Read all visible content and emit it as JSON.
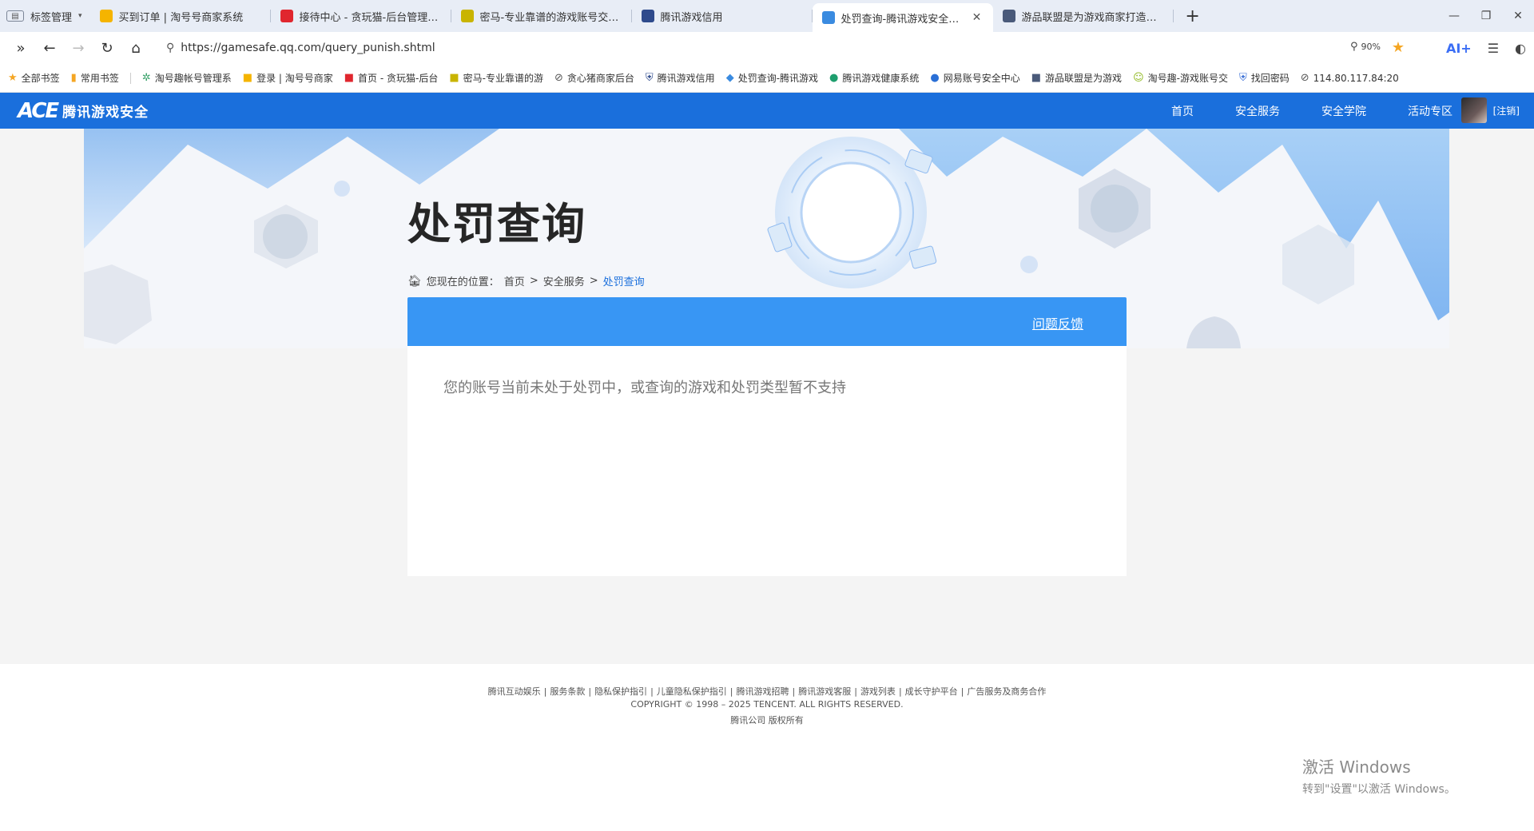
{
  "browser": {
    "tab_manager_label": "标签管理",
    "tabs": [
      {
        "title": "买到订单 | 淘号号商家系统",
        "favicon_color": "#f5b400"
      },
      {
        "title": "接待中心 - 贪玩猫-后台管理系统",
        "favicon_color": "#e0262e"
      },
      {
        "title": "密马-专业靠谱的游戏账号交易平",
        "favicon_color": "#c9b400"
      },
      {
        "title": "腾讯游戏信用",
        "favicon_color": "#2e4a8c"
      },
      {
        "title": "处罚查询-腾讯游戏安全中心官",
        "favicon_color": "#3a8be0",
        "active": true
      },
      {
        "title": "游品联盟是为游戏商家打造的专",
        "favicon_color": "#4a5a7a"
      }
    ],
    "url": "https://gamesafe.qq.com/query_punish.shtml",
    "zoom": "90%",
    "ai_label": "AI+",
    "bookmarks": [
      {
        "label": "全部书签",
        "icon": "star-icon",
        "color": "#f5a623"
      },
      {
        "label": "常用书签",
        "icon": "bookmark-icon",
        "color": "#f5a623"
      },
      {
        "label": "淘号趣帐号管理系",
        "icon": "leaf-icon",
        "color": "#3aa36b"
      },
      {
        "label": "登录 | 淘号号商家",
        "icon": "logo-icon",
        "color": "#f5b400"
      },
      {
        "label": "首页 - 贪玩猫-后台",
        "icon": "logo-icon",
        "color": "#e0262e"
      },
      {
        "label": "密马-专业靠谱的游",
        "icon": "logo-icon",
        "color": "#c9b400"
      },
      {
        "label": "贪心猪商家后台",
        "icon": "link-icon",
        "color": "#555555"
      },
      {
        "label": "腾讯游戏信用",
        "icon": "shield-icon",
        "color": "#2e4a8c"
      },
      {
        "label": "处罚查询-腾讯游戏",
        "icon": "diamond-icon",
        "color": "#3a8be0"
      },
      {
        "label": "腾讯游戏健康系统",
        "icon": "circle-icon",
        "color": "#1e9e6e"
      },
      {
        "label": "网易账号安全中心",
        "icon": "circle-icon",
        "color": "#2a6fd6"
      },
      {
        "label": "游品联盟是为游戏",
        "icon": "logo-icon",
        "color": "#4a5a7a"
      },
      {
        "label": "淘号趣-游戏账号交",
        "icon": "face-icon",
        "color": "#8fb81e"
      },
      {
        "label": "找回密码",
        "icon": "shield-icon",
        "color": "#3a6fd6"
      },
      {
        "label": "114.80.117.84:20",
        "icon": "link-icon",
        "color": "#555555"
      }
    ]
  },
  "site": {
    "logo_mark": "ACE",
    "logo_text": "腾讯游戏安全",
    "nav": [
      "首页",
      "安全服务",
      "安全学院",
      "活动专区"
    ],
    "user_action": "[注销]"
  },
  "page": {
    "title": "处罚查询",
    "breadcrumb": {
      "prefix": "您现在的位置：",
      "items": [
        "首页",
        "安全服务"
      ],
      "separator": ">",
      "current": "处罚查询"
    },
    "feedback_label": "问题反馈",
    "result_message": "您的账号当前未处于处罚中，或查询的游戏和处罚类型暂不支持"
  },
  "footer": {
    "links": [
      "腾讯互动娱乐",
      "服务条款",
      "隐私保护指引",
      "儿童隐私保护指引",
      "腾讯游戏招聘",
      "腾讯游戏客服",
      "游戏列表",
      "成长守护平台",
      "广告服务及商务合作"
    ],
    "separator": "|",
    "copyright": "COPYRIGHT © 1998 – 2025 TENCENT. ALL RIGHTS RESERVED.",
    "company": "腾讯公司 版权所有"
  },
  "watermark": {
    "line1": "激活 Windows",
    "line2": "转到\"设置\"以激活 Windows。"
  },
  "colors": {
    "header_blue": "#1a6fdc",
    "panel_blue": "#3896f4",
    "page_bg": "#f4f4f4"
  }
}
